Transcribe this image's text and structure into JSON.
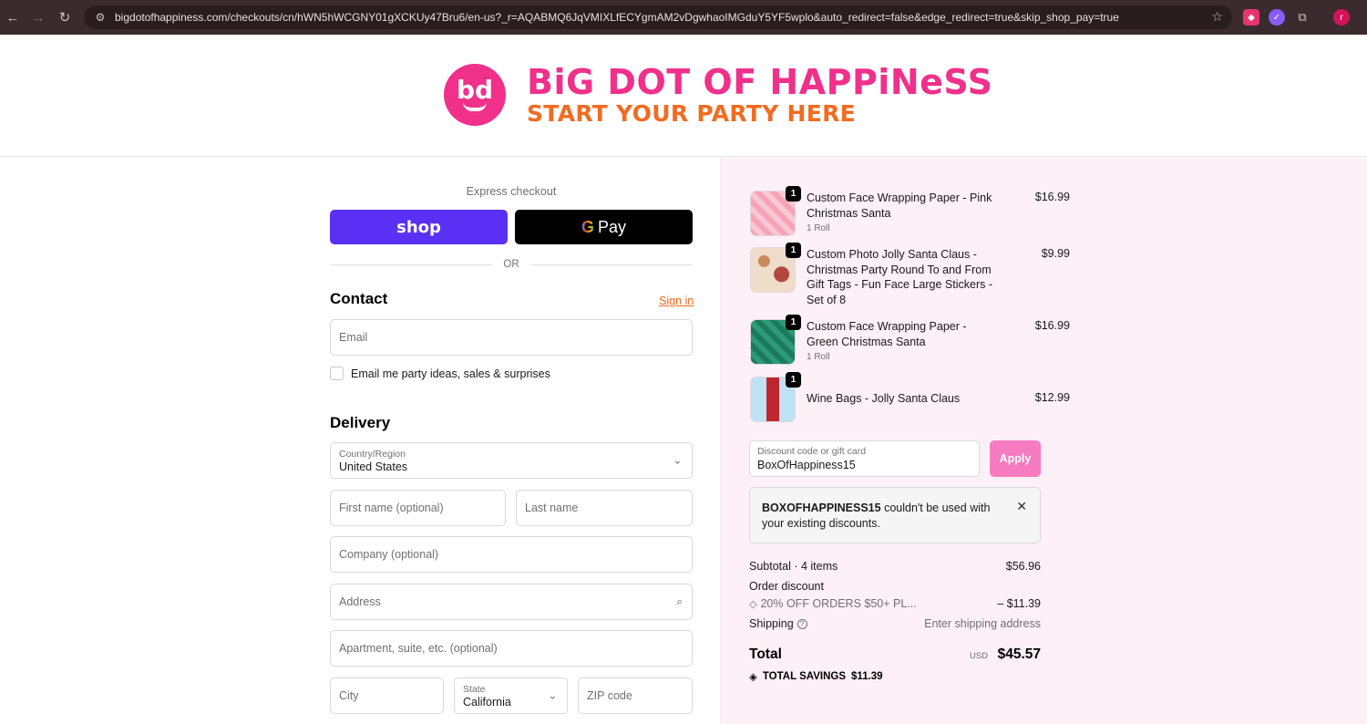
{
  "browser": {
    "url": "bigdotofhappiness.com/checkouts/cn/hWN5hWCGNY01gXCKUy47Bru6/en-us?_r=AQABMQ6JqVMIXLfECYgmAM2vDgwhaoIMGduY5YF5wplo&auto_redirect=false&edge_redirect=true&skip_shop_pay=true",
    "avatar_letter": "r"
  },
  "brand": {
    "logo_mark": "bd",
    "name": "BiG DOT OF HAPPiNeSS",
    "tagline": "START YOUR PARTY HERE",
    "pink": "#f0308b",
    "orange": "#f26b21"
  },
  "express": {
    "label": "Express checkout",
    "shop_label": "shop",
    "gpay_g": "G",
    "gpay_label": "Pay",
    "or_label": "OR"
  },
  "contact": {
    "title": "Contact",
    "signin_label": "Sign in",
    "email_placeholder": "Email",
    "marketing_label": "Email me party ideas, sales & surprises"
  },
  "delivery": {
    "title": "Delivery",
    "country_label": "Country/Region",
    "country_value": "United States",
    "first_name_placeholder": "First name (optional)",
    "last_name_placeholder": "Last name",
    "company_placeholder": "Company (optional)",
    "address_placeholder": "Address",
    "apartment_placeholder": "Apartment, suite, etc. (optional)",
    "city_placeholder": "City",
    "state_label": "State",
    "state_value": "California",
    "zip_placeholder": "ZIP code"
  },
  "cart": {
    "items": [
      {
        "name": "Custom Face Wrapping Paper - Pink Christmas Santa",
        "variant": "1 Roll",
        "price": "$16.99",
        "qty": "1"
      },
      {
        "name": "Custom Photo Jolly Santa Claus - Christmas Party Round To and From Gift Tags - Fun Face Large Stickers - Set of 8",
        "variant": "",
        "price": "$9.99",
        "qty": "1"
      },
      {
        "name": "Custom Face Wrapping Paper - Green Christmas Santa",
        "variant": "1 Roll",
        "price": "$16.99",
        "qty": "1"
      },
      {
        "name": "Wine Bags - Jolly Santa Claus",
        "variant": "",
        "price": "$12.99",
        "qty": "1"
      }
    ],
    "discount_label": "Discount code or gift card",
    "discount_value": "BoxOfHappiness15",
    "apply_label": "Apply",
    "alert_code": "BOXOFHAPPINESS15",
    "alert_msg": " couldn't be used with your existing discounts.",
    "subtotal_label": "Subtotal · 4 items",
    "subtotal_value": "$56.96",
    "order_discount_label": "Order discount",
    "discount_name": "20% OFF ORDERS $50+ PL...",
    "discount_amount": "– $11.39",
    "shipping_label": "Shipping",
    "shipping_value": "Enter shipping address",
    "total_label": "Total",
    "currency": "USD",
    "total_value": "$45.57",
    "savings_label": "TOTAL SAVINGS",
    "savings_value": "$11.39"
  }
}
